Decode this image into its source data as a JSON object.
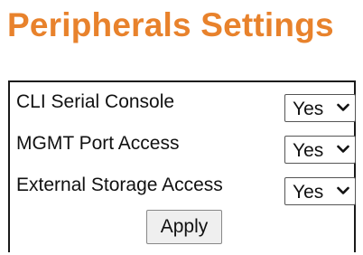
{
  "page": {
    "title": "Peripherals Settings",
    "title_color": "#E8822C"
  },
  "settings": [
    {
      "label": "CLI Serial Console",
      "value": "Yes"
    },
    {
      "label": "MGMT Port Access",
      "value": "Yes"
    },
    {
      "label": "External Storage Access",
      "value": "Yes"
    }
  ],
  "actions": {
    "apply_label": "Apply"
  },
  "icons": {
    "dropdown": "chevron-down-icon"
  }
}
